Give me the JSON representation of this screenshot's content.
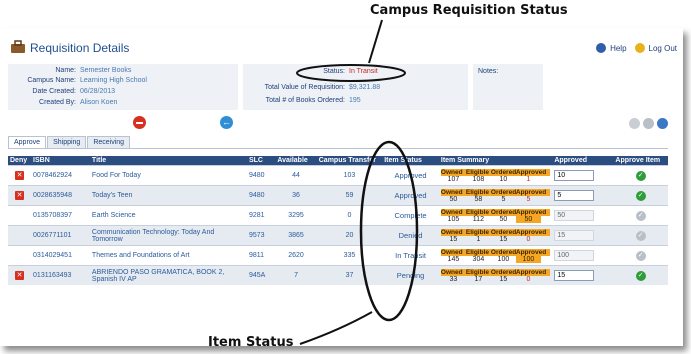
{
  "annotations": {
    "campus_status_label": "Campus Requisition Status",
    "item_status_label": "Item Status"
  },
  "header": {
    "title": "Requisition Details",
    "help_label": "Help",
    "logout_label": "Log Out"
  },
  "details": {
    "name_label": "Name:",
    "name_value": "Semester Books",
    "campus_label": "Campus Name:",
    "campus_value": "Learning High School",
    "date_label": "Date Created:",
    "date_value": "06/28/2013",
    "created_by_label": "Created By:",
    "created_by_value": "Alison Koen",
    "status_label": "Status:",
    "status_value": "In Transit",
    "total_value_label": "Total Value of Requisition:",
    "total_value": "$9,321.88",
    "total_books_label": "Total # of Books Ordered:",
    "total_books": "195",
    "notes_label": "Notes:"
  },
  "tabs": [
    "Approve",
    "Shipping",
    "Receiving"
  ],
  "table": {
    "headers": {
      "deny": "Deny",
      "isbn": "ISBN",
      "title": "Title",
      "slc": "SLC",
      "available": "Available",
      "campus_transfer": "Campus Transfer",
      "item_status": "Item Status",
      "item_summary": "Item Summary",
      "approved": "Approved",
      "approve_item": "Approve Item"
    },
    "summary_headers": [
      "Owned",
      "Eligible",
      "Ordered",
      "Approved"
    ],
    "rows": [
      {
        "isbn": "0078462924",
        "title": "Food For Today",
        "slc": "9480",
        "available": "44",
        "transfer": "103",
        "status": "Approved",
        "owned": "107",
        "eligible": "108",
        "ordered": "10",
        "approved": "1",
        "approved_input": "10"
      },
      {
        "isbn": "0028635948",
        "title": "Today's Teen",
        "slc": "9480",
        "available": "36",
        "transfer": "59",
        "status": "Approved",
        "owned": "50",
        "eligible": "58",
        "ordered": "5",
        "approved": "5",
        "approved_input": "5"
      },
      {
        "isbn": "0135708397",
        "title": "Earth Science",
        "slc": "9281",
        "available": "3295",
        "transfer": "0",
        "status": "Complete",
        "owned": "105",
        "eligible": "112",
        "ordered": "50",
        "approved": "50",
        "approved_input": "50"
      },
      {
        "isbn": "0026771101",
        "title": "Communication Technology: Today And Tomorrow",
        "slc": "9573",
        "available": "3865",
        "transfer": "20",
        "status": "Denied",
        "owned": "15",
        "eligible": "1",
        "ordered": "15",
        "approved": "0",
        "approved_input": "15"
      },
      {
        "isbn": "0314029451",
        "title": "Themes and Foundations of Art",
        "slc": "9811",
        "available": "2620",
        "transfer": "335",
        "status": "In Transit",
        "owned": "145",
        "eligible": "304",
        "ordered": "100",
        "approved": "100",
        "approved_input": "100"
      },
      {
        "isbn": "0131163493",
        "title": "ABRIENDO PASO GRAMATICA, BOOK 2, Spanish IV AP",
        "slc": "945A",
        "available": "7",
        "transfer": "37",
        "status": "Pending",
        "owned": "33",
        "eligible": "17",
        "ordered": "15",
        "approved": "0",
        "approved_input": "15"
      }
    ]
  },
  "colors": {
    "header_bg": "#2b4d80",
    "summary_orange": "#f5a623",
    "status_red": "#c62828",
    "approve_green": "#2e9d3a"
  }
}
